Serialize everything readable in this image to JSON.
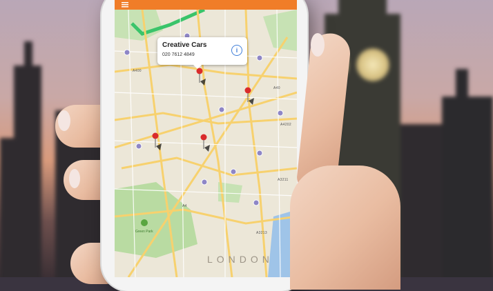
{
  "app": {
    "accent_color": "#f07d28",
    "menu_icon": "menu-icon"
  },
  "map": {
    "callout": {
      "title": "Creative Cars",
      "phone": "020 7612 4849",
      "info_icon": "info-icon"
    },
    "area_label": "LONDON",
    "road_labels": [
      "A400",
      "A40",
      "A4202",
      "A3211",
      "A4",
      "A3213"
    ],
    "park_label": "Green Park",
    "pin_color": "#d92b2b",
    "station_color": "#8e86c6"
  }
}
